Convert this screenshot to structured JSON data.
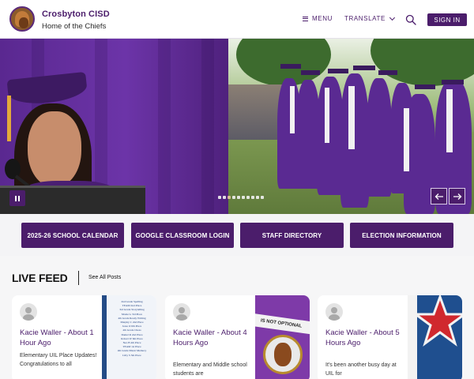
{
  "header": {
    "site_name": "Crosbyton CISD",
    "tagline": "Home of the Chiefs",
    "menu_label": "MENU",
    "translate_label": "TRANSLATE",
    "signin_label": "SIGN IN"
  },
  "hero": {
    "slide_count": 10,
    "active_slide": 3
  },
  "quick_links": [
    {
      "label": "2025-26 SCHOOL CALENDAR"
    },
    {
      "label": "GOOGLE CLASSROOM LOGIN"
    },
    {
      "label": "STAFF DIRECTORY"
    },
    {
      "label": "ELECTION INFORMATION"
    }
  ],
  "live_feed": {
    "title": "LIVE FEED",
    "see_all": "See All Posts",
    "posts": [
      {
        "author": "Kacie Waller - About 1 Hour Ago",
        "excerpt": "Elementary UIL Place Updates! Congratulations to all"
      },
      {
        "author": "Kacie Waller - About 4 Hours Ago",
        "excerpt": "Elementary and Middle school students are"
      },
      {
        "author": "Kacie Waller - About 5 Hours Ago",
        "excerpt": "It's been another busy day at UIL for"
      }
    ],
    "post2_image_text": "IS NOT OPTIONAL",
    "post1_image_lines": [
      "2nd Grade Spelling",
      "TEAM 2nd Place",
      "3rd Grade Storytelling",
      "Mazie G 3rd Place",
      "4th Grade Ready Writing",
      "Murphy C 2nd Place",
      "Jesse O 6th Place",
      "4th Grade Chess",
      "Daniel R 2nd Place",
      "Robert W 6th Place",
      "Neo B 4th Place",
      "TEAM 1st Place",
      "4th Grade Music Memory",
      "Lilly S 5th Place"
    ]
  },
  "colors": {
    "brand_purple": "#4b1d6b",
    "accent_red": "#d0282e",
    "accent_blue": "#1f4f8f"
  }
}
